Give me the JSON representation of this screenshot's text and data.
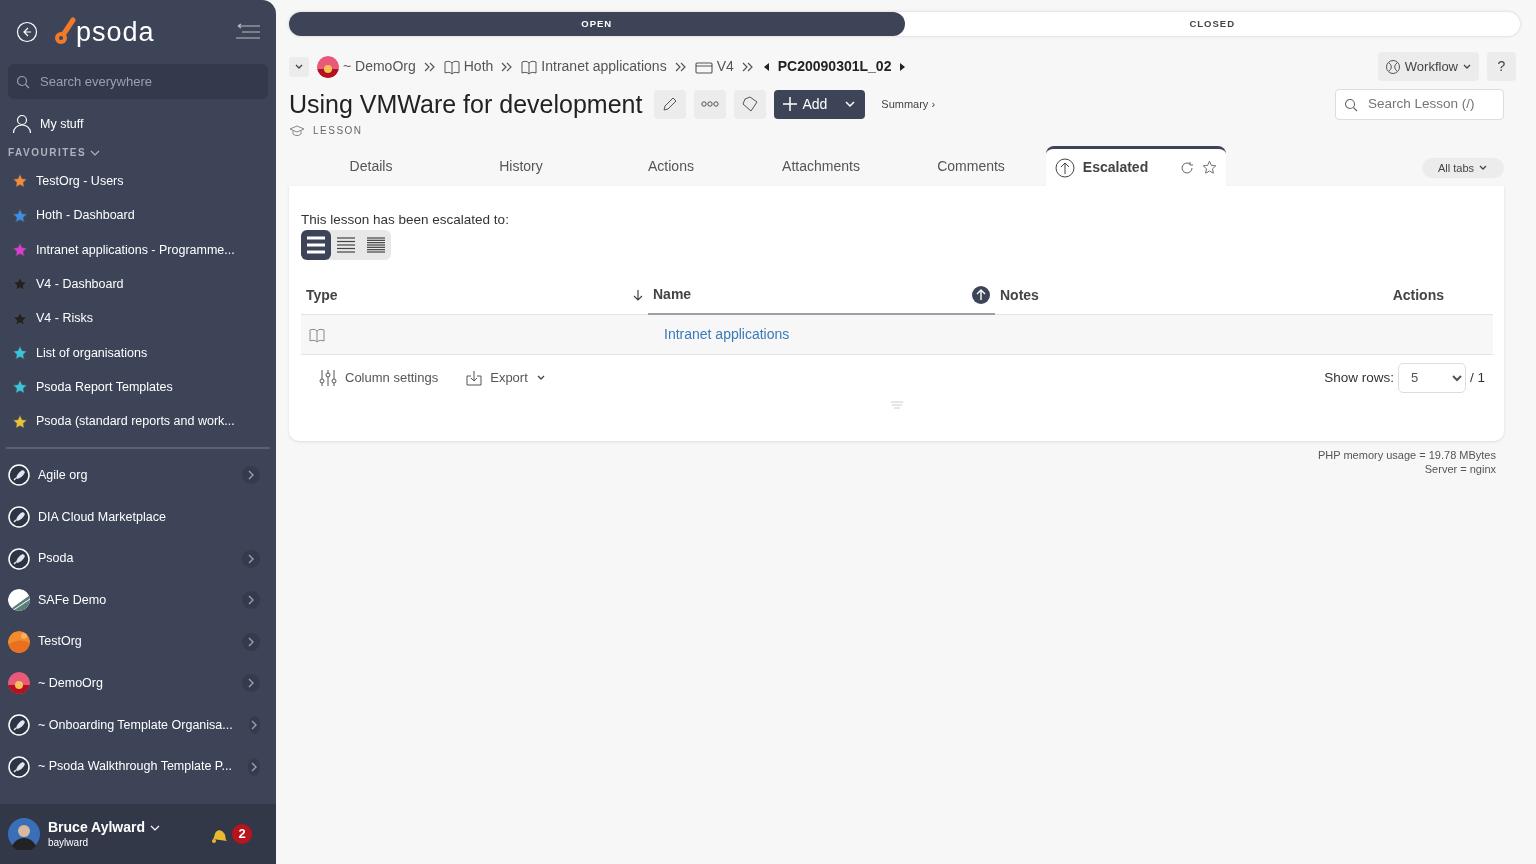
{
  "sidebar": {
    "logo": "psoda",
    "search": {
      "placeholder": "Search everywhere"
    },
    "my_stuff": "My stuff",
    "favourites_heading": "FAVOURITES",
    "favourites": [
      {
        "label": "TestOrg - Users",
        "color": "#f28c3c"
      },
      {
        "label": "Hoth - Dashboard",
        "color": "#3b8fe6"
      },
      {
        "label": "Intranet applications - Programme...",
        "color": "#e03ad6"
      },
      {
        "label": "V4 - Dashboard",
        "color": "#222222"
      },
      {
        "label": "V4 - Risks",
        "color": "#222222"
      },
      {
        "label": "List of organisations",
        "color": "#38c6dc"
      },
      {
        "label": "Psoda Report Templates",
        "color": "#38c6dc"
      },
      {
        "label": "Psoda (standard reports and work...",
        "color": "#e8c23a"
      }
    ],
    "orgs": [
      {
        "label": "Agile org",
        "kind": "rocket",
        "expandable": true
      },
      {
        "label": "DIA Cloud Marketplace",
        "kind": "rocket",
        "expandable": false
      },
      {
        "label": "Psoda",
        "kind": "rocket",
        "expandable": true
      },
      {
        "label": "SAFe Demo",
        "kind": "picture",
        "expandable": true
      },
      {
        "label": "TestOrg",
        "kind": "picture",
        "expandable": true
      },
      {
        "label": "~ DemoOrg",
        "kind": "picture",
        "expandable": true
      },
      {
        "label": "~ Onboarding Template Organisa...",
        "kind": "rocket",
        "expandable": true
      },
      {
        "label": "~ Psoda Walkthrough Template P...",
        "kind": "rocket",
        "expandable": true
      }
    ],
    "user": {
      "name": "Bruce Aylward",
      "username": "baylward",
      "notifications": "2"
    }
  },
  "status_stages": [
    {
      "label": "OPEN",
      "selected": true
    },
    {
      "label": "CLOSED",
      "selected": false
    }
  ],
  "breadcrumbs": [
    {
      "label": "~ DemoOrg",
      "kind": "org"
    },
    {
      "label": "Hoth",
      "kind": "book"
    },
    {
      "label": "Intranet applications",
      "kind": "book"
    },
    {
      "label": "V4",
      "kind": "folder"
    }
  ],
  "current_item": "PC20090301L_02",
  "title": "Using VMWare for development",
  "item_type": "LESSON",
  "add_button": "Add",
  "summary_link": "Summary ›",
  "workflow_button": "Workflow",
  "help_button": "?",
  "search": {
    "placeholder": "Search Lesson (/)"
  },
  "tabs": [
    {
      "label": "Details",
      "selected": false
    },
    {
      "label": "History",
      "selected": false
    },
    {
      "label": "Actions",
      "selected": false
    },
    {
      "label": "Attachments",
      "selected": false
    },
    {
      "label": "Comments",
      "selected": false
    },
    {
      "label": "Escalated",
      "selected": true
    }
  ],
  "all_tabs": "All tabs",
  "panel": {
    "intro": "This lesson has been escalated to:",
    "densities": [
      {
        "selected": true
      },
      {
        "selected": false
      },
      {
        "selected": false
      }
    ],
    "table": {
      "columns": [
        {
          "label": "Type",
          "sortable": true,
          "sorted": false
        },
        {
          "label": "Name",
          "sorted": true
        },
        {
          "label": "Notes",
          "sortable": false,
          "sorted": false
        },
        {
          "label": "Actions",
          "sortable": false,
          "sorted": false
        }
      ],
      "rows": [
        {
          "kind": "book",
          "name": "Intranet applications"
        }
      ]
    },
    "column_settings": "Column settings",
    "export": "Export",
    "show_rows_label": "Show rows:",
    "show_rows": "5",
    "pages": "/ 1"
  },
  "footer": [
    "PHP memory usage = 19.78 MBytes",
    "Server = nginx"
  ]
}
